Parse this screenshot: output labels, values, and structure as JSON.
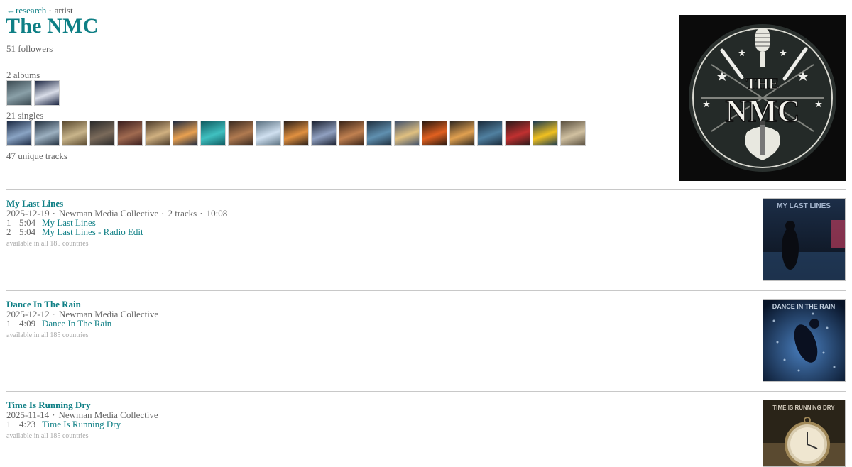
{
  "nav": {
    "back": "←research",
    "separator": "·",
    "section": "artist"
  },
  "artist": {
    "name": "The NMC",
    "followers": "51 followers",
    "logo_text": "THE NMC"
  },
  "albums": {
    "label": "2 albums",
    "thumbs": [
      {
        "colors": [
          "#3b4a52",
          "#8aa0a8"
        ]
      },
      {
        "colors": [
          "#1a2440",
          "#d9dde8"
        ]
      }
    ]
  },
  "singles": {
    "label": "21 singles",
    "thumbs": [
      {
        "colors": [
          "#1c2a44",
          "#8aa4c4"
        ]
      },
      {
        "colors": [
          "#22303f",
          "#9cb0c0"
        ]
      },
      {
        "colors": [
          "#5a4a30",
          "#c8b48a"
        ]
      },
      {
        "colors": [
          "#2a2a2a",
          "#7a6a5a"
        ]
      },
      {
        "colors": [
          "#3a1e1e",
          "#a06a50"
        ]
      },
      {
        "colors": [
          "#4a3a2a",
          "#d0b080"
        ]
      },
      {
        "colors": [
          "#1e2a40",
          "#e8a050"
        ]
      },
      {
        "colors": [
          "#0e5a60",
          "#40c0c0"
        ]
      },
      {
        "colors": [
          "#3a2a20",
          "#b07a50"
        ]
      },
      {
        "colors": [
          "#5a7080",
          "#d0e0f0"
        ]
      },
      {
        "colors": [
          "#2a1e18",
          "#e09040"
        ]
      },
      {
        "colors": [
          "#1a2030",
          "#90a0c0"
        ]
      },
      {
        "colors": [
          "#3a2418",
          "#c08050"
        ]
      },
      {
        "colors": [
          "#203040",
          "#6090b0"
        ]
      },
      {
        "colors": [
          "#40506a",
          "#e0c080"
        ]
      },
      {
        "colors": [
          "#2a1a10",
          "#e06020"
        ]
      },
      {
        "colors": [
          "#302820",
          "#e0a050"
        ]
      },
      {
        "colors": [
          "#1a2a3a",
          "#5080a0"
        ]
      },
      {
        "colors": [
          "#2a1a1a",
          "#c03030"
        ]
      },
      {
        "colors": [
          "#1a3a50",
          "#f0c020"
        ]
      },
      {
        "colors": [
          "#5a5040",
          "#d0c0a0"
        ]
      }
    ]
  },
  "unique_tracks": "47 unique tracks",
  "separator": "·",
  "releases": [
    {
      "title": "My Last Lines",
      "date": "2025-12-19",
      "label": "Newman Media Collective",
      "track_count": "2 tracks",
      "total": "10:08",
      "tracks": [
        {
          "num": "1",
          "dur": "5:04",
          "name": "My Last Lines"
        },
        {
          "num": "2",
          "dur": "5:04",
          "name": "My Last Lines - Radio Edit"
        }
      ],
      "availability": "available in all 185 countries",
      "cover_text": "My Last Lines",
      "cover_colors": [
        "#101a2a",
        "#3a6a9a",
        "#d04060"
      ]
    },
    {
      "title": "Dance In The Rain",
      "date": "2025-12-12",
      "label": "Newman Media Collective",
      "tracks": [
        {
          "num": "1",
          "dur": "4:09",
          "name": "Dance In The Rain"
        }
      ],
      "availability": "available in all 185 countries",
      "cover_text": "Dance In The Rain",
      "cover_colors": [
        "#0a1a30",
        "#3a6ab0",
        "#c0d8f0"
      ]
    },
    {
      "title": "Time Is Running Dry",
      "date": "2025-11-14",
      "label": "Newman Media Collective",
      "tracks": [
        {
          "num": "1",
          "dur": "4:23",
          "name": "Time Is Running Dry"
        }
      ],
      "availability": "available in all 185 countries",
      "cover_text": "Time Is Running Dry",
      "cover_colors": [
        "#2a2418",
        "#8a7a5a",
        "#e8d8b0"
      ]
    }
  ]
}
